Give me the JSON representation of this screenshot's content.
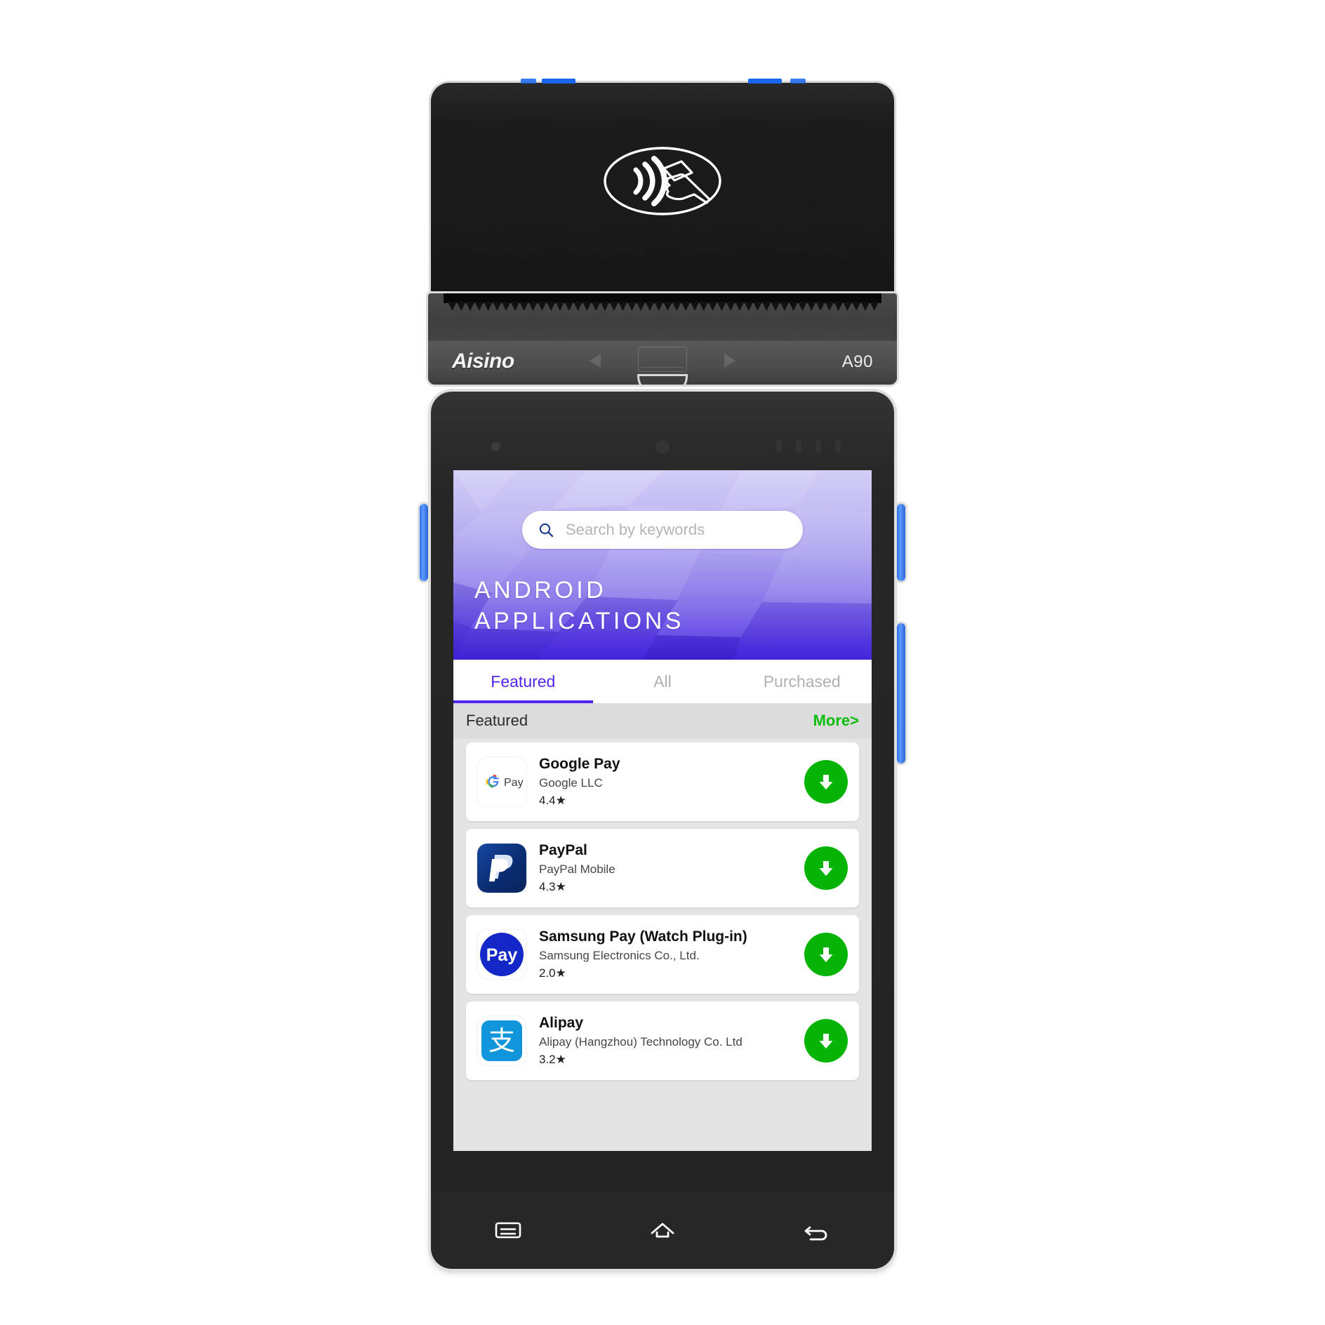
{
  "device": {
    "brand": "Aisino",
    "model": "A90",
    "nfc_icon": "contactless-payment-icon"
  },
  "screen": {
    "banner": {
      "title_line1": "ANDROID",
      "title_line2": "APPLICATIONS",
      "search": {
        "placeholder": "Search by keywords",
        "value": "",
        "icon": "search-icon"
      },
      "gradient_from": "#cfcaf6",
      "gradient_to": "#4526dd"
    },
    "tabs": [
      {
        "label": "Featured",
        "active": true
      },
      {
        "label": "All",
        "active": false
      },
      {
        "label": "Purchased",
        "active": false
      }
    ],
    "active_tab_color": "#5424ef",
    "section": {
      "title": "Featured",
      "more_label": "More>",
      "more_color": "#0bbe0b"
    },
    "apps": [
      {
        "name": "Google Pay",
        "developer": "Google LLC",
        "rating": "4.4",
        "star": "★",
        "icon": "google-pay-icon",
        "action": "download-button"
      },
      {
        "name": "PayPal",
        "developer": "PayPal Mobile",
        "rating": "4.3",
        "star": "★",
        "icon": "paypal-icon",
        "action": "download-button"
      },
      {
        "name": "Samsung Pay (Watch Plug-in)",
        "developer": "Samsung Electronics Co.,  Ltd.",
        "rating": "2.0",
        "star": "★",
        "icon": "samsung-pay-icon",
        "action": "download-button"
      },
      {
        "name": "Alipay",
        "developer": "Alipay (Hangzhou) Technology Co. Ltd",
        "rating": "3.2",
        "star": "★",
        "icon": "alipay-icon",
        "action": "download-button"
      }
    ],
    "download_button_color": "#06b406",
    "navbar": [
      {
        "icon": "recents-menu-icon"
      },
      {
        "icon": "home-icon"
      },
      {
        "icon": "back-icon"
      }
    ]
  }
}
